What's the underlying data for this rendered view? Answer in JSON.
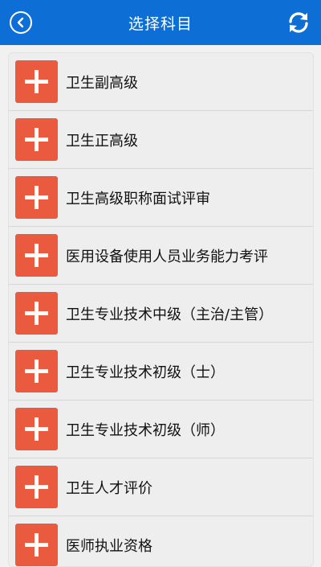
{
  "header": {
    "title": "选择科目",
    "back_icon": "back-circle-icon",
    "refresh_icon": "refresh-icon",
    "color": "#0d6fd6"
  },
  "list": {
    "icon": "plus-icon",
    "icon_color": "#ea5a3f",
    "items": [
      {
        "label": "卫生副高级"
      },
      {
        "label": "卫生正高级"
      },
      {
        "label": "卫生高级职称面试评审"
      },
      {
        "label": "医用设备使用人员业务能力考评"
      },
      {
        "label": "卫生专业技术中级（主治/主管）"
      },
      {
        "label": "卫生专业技术初级（士）"
      },
      {
        "label": "卫生专业技术初级（师）"
      },
      {
        "label": "卫生人才评价"
      },
      {
        "label": "医师执业资格"
      }
    ]
  }
}
